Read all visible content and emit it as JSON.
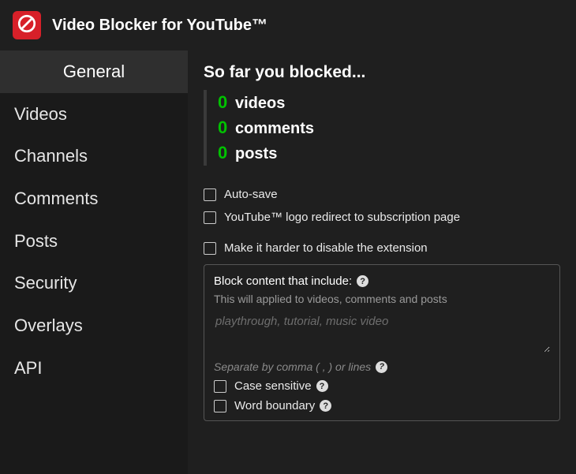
{
  "app": {
    "title": "Video Blocker for YouTube™"
  },
  "sidebar": {
    "items": [
      {
        "label": "General",
        "active": true
      },
      {
        "label": "Videos",
        "active": false
      },
      {
        "label": "Channels",
        "active": false
      },
      {
        "label": "Comments",
        "active": false
      },
      {
        "label": "Posts",
        "active": false
      },
      {
        "label": "Security",
        "active": false
      },
      {
        "label": "Overlays",
        "active": false
      },
      {
        "label": "API",
        "active": false
      }
    ]
  },
  "general": {
    "stats_title": "So far you blocked...",
    "stats": [
      {
        "count": "0",
        "label": "videos"
      },
      {
        "count": "0",
        "label": "comments"
      },
      {
        "count": "0",
        "label": "posts"
      }
    ],
    "checkboxes_top": [
      {
        "label": "Auto-save",
        "checked": false
      },
      {
        "label": "YouTube™ logo redirect to subscription page",
        "checked": false
      }
    ],
    "checkboxes_mid": [
      {
        "label": "Make it harder to disable the extension",
        "checked": false
      }
    ],
    "keyword_panel": {
      "title": "Block content that include:",
      "description": "This will applied to videos, comments and posts",
      "placeholder": "playthrough, tutorial, music video",
      "value": "",
      "separator_hint": "Separate by comma ( , ) or lines",
      "checkboxes": [
        {
          "label": "Case sensitive",
          "checked": false
        },
        {
          "label": "Word boundary",
          "checked": false
        }
      ]
    }
  },
  "colors": {
    "accent_red": "#d72029",
    "count_green": "#00c200"
  }
}
